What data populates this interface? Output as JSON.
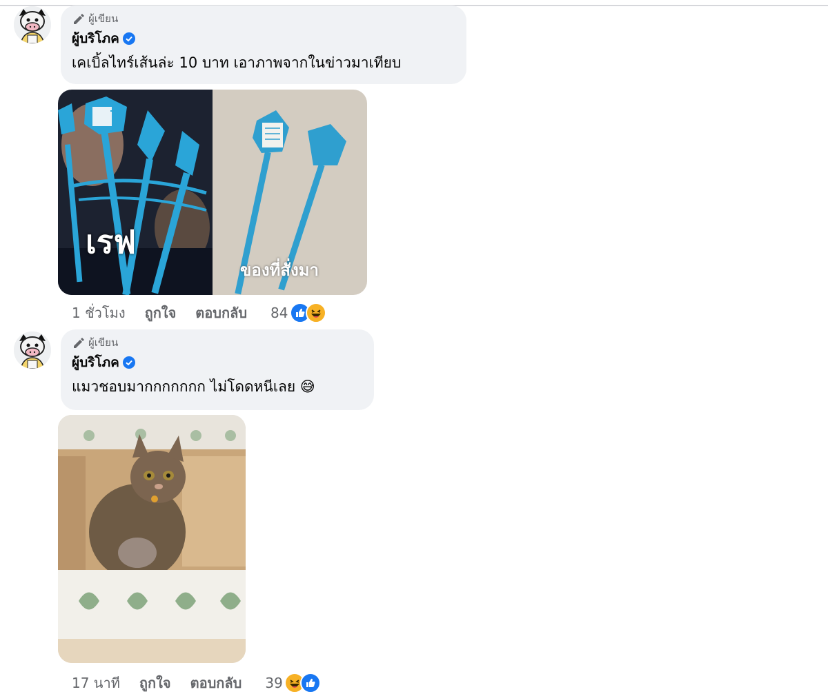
{
  "comments": [
    {
      "badge_label": "ผู้เขียน",
      "author": "ผู้บริโภค",
      "text": "เคเบิ้ลไทร์เส้นล่ะ 10 บาท เอาภาพจากในข่าวมาเทียบ",
      "image": {
        "left_caption": "เรฟ",
        "right_caption": "ของที่สั่งมา"
      },
      "time": "1 ชั่วโมง",
      "like_label": "ถูกใจ",
      "reply_label": "ตอบกลับ",
      "reaction_count": "84",
      "reaction_icons": [
        "like-icon",
        "haha-icon"
      ]
    },
    {
      "badge_label": "ผู้เขียน",
      "author": "ผู้บริโภค",
      "text": "แมวชอบมากกกกกกก ไม่โดดหนีเลย",
      "emoji": "😅",
      "time": "17 นาที",
      "like_label": "ถูกใจ",
      "reply_label": "ตอบกลับ",
      "reaction_count": "39",
      "reaction_icons": [
        "haha-icon",
        "like-icon"
      ]
    }
  ],
  "colors": {
    "bubble_bg": "#f0f2f5",
    "verified_blue": "#1877f2",
    "meta_gray": "#65676b",
    "cable_blue": "#2aa5d8"
  }
}
